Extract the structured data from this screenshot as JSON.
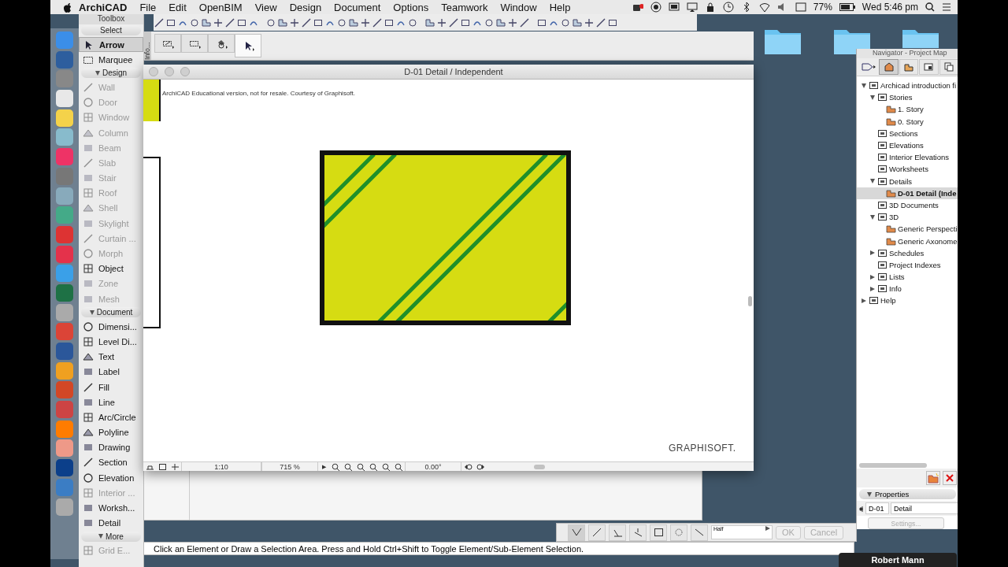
{
  "menu_bar": {
    "app_name": "ArchiCAD",
    "menus": [
      "File",
      "Edit",
      "OpenBIM",
      "View",
      "Design",
      "Document",
      "Options",
      "Teamwork",
      "Window",
      "Help"
    ],
    "battery": "77%",
    "clock": "Wed 5:46 pm"
  },
  "toolbox": {
    "title": "Toolbox",
    "sections": [
      {
        "title": "Select",
        "items": [
          {
            "label": "Arrow",
            "selected": true,
            "disabled": false
          },
          {
            "label": "Marquee",
            "selected": false,
            "disabled": false
          }
        ]
      },
      {
        "title": "Design",
        "expanded": true,
        "items": [
          {
            "label": "Wall",
            "selected": false,
            "disabled": true
          },
          {
            "label": "Door",
            "selected": false,
            "disabled": true
          },
          {
            "label": "Window",
            "selected": false,
            "disabled": true
          },
          {
            "label": "Column",
            "selected": false,
            "disabled": true
          },
          {
            "label": "Beam",
            "selected": false,
            "disabled": true
          },
          {
            "label": "Slab",
            "selected": false,
            "disabled": true
          },
          {
            "label": "Stair",
            "selected": false,
            "disabled": true
          },
          {
            "label": "Roof",
            "selected": false,
            "disabled": true
          },
          {
            "label": "Shell",
            "selected": false,
            "disabled": true
          },
          {
            "label": "Skylight",
            "selected": false,
            "disabled": true
          },
          {
            "label": "Curtain ...",
            "selected": false,
            "disabled": true
          },
          {
            "label": "Morph",
            "selected": false,
            "disabled": true
          },
          {
            "label": "Object",
            "selected": false,
            "disabled": false
          },
          {
            "label": "Zone",
            "selected": false,
            "disabled": true
          },
          {
            "label": "Mesh",
            "selected": false,
            "disabled": true
          }
        ]
      },
      {
        "title": "Document",
        "expanded": true,
        "items": [
          {
            "label": "Dimensi...",
            "selected": false,
            "disabled": false
          },
          {
            "label": "Level Di...",
            "selected": false,
            "disabled": false
          },
          {
            "label": "Text",
            "selected": false,
            "disabled": false
          },
          {
            "label": "Label",
            "selected": false,
            "disabled": false
          },
          {
            "label": "Fill",
            "selected": false,
            "disabled": false
          },
          {
            "label": "Line",
            "selected": false,
            "disabled": false
          },
          {
            "label": "Arc/Circle",
            "selected": false,
            "disabled": false
          },
          {
            "label": "Polyline",
            "selected": false,
            "disabled": false
          },
          {
            "label": "Drawing",
            "selected": false,
            "disabled": false
          },
          {
            "label": "Section",
            "selected": false,
            "disabled": false
          },
          {
            "label": "Elevation",
            "selected": false,
            "disabled": false
          },
          {
            "label": "Interior ...",
            "selected": false,
            "disabled": true
          },
          {
            "label": "Worksh...",
            "selected": false,
            "disabled": false
          },
          {
            "label": "Detail",
            "selected": false,
            "disabled": false
          }
        ]
      },
      {
        "title": "More",
        "expanded": true,
        "items": [
          {
            "label": "Grid E...",
            "selected": false,
            "disabled": true
          }
        ]
      }
    ]
  },
  "info_box": {
    "tab": "Info...",
    "tools": [
      {
        "selected": false
      },
      {
        "selected": false
      },
      {
        "selected": false
      },
      {
        "selected": true
      }
    ]
  },
  "drawing_window": {
    "title": "D-01 Detail / Independent",
    "notice": "ArchiCAD Educational version, not for resale. Courtesy of Graphisoft.",
    "logo": "GRAPHISOFT.",
    "scale": "1:10",
    "zoom": "715 %",
    "play": "▶",
    "angle": "0.00°"
  },
  "navigator": {
    "title": "Navigator - Project Map",
    "tabs": [
      {
        "selected": true
      },
      {
        "selected": false
      },
      {
        "selected": false
      },
      {
        "selected": false
      }
    ],
    "tree": [
      {
        "label": "Archicad introduction fi",
        "expanded": true,
        "selected": false,
        "children": [
          {
            "label": "Stories",
            "expanded": true,
            "selected": false,
            "children": [
              {
                "label": "1. Story",
                "selected": false
              },
              {
                "label": "0. Story",
                "selected": false
              }
            ]
          },
          {
            "label": "Sections",
            "selected": false
          },
          {
            "label": "Elevations",
            "selected": false
          },
          {
            "label": "Interior Elevations",
            "selected": false
          },
          {
            "label": "Worksheets",
            "selected": false
          },
          {
            "label": "Details",
            "expanded": true,
            "selected": false,
            "children": [
              {
                "label": "D-01 Detail (Inde",
                "selected": true
              }
            ]
          },
          {
            "label": "3D Documents",
            "selected": false
          },
          {
            "label": "3D",
            "expanded": true,
            "selected": false,
            "children": [
              {
                "label": "Generic Perspecti",
                "selected": false
              },
              {
                "label": "Generic Axonome",
                "selected": false
              }
            ]
          },
          {
            "label": "Schedules",
            "expanded": false,
            "selected": false
          },
          {
            "label": "Project Indexes",
            "selected": false
          },
          {
            "label": "Lists",
            "expanded": false,
            "selected": false
          },
          {
            "label": "Info",
            "expanded": false,
            "selected": false
          }
        ]
      },
      {
        "label": "Help",
        "expanded": false,
        "selected": false
      }
    ],
    "properties": {
      "title": "Properties",
      "expanded": true,
      "id": "D-01",
      "name": "Detail",
      "settings": "Settings...",
      "settings_disabled": true
    }
  },
  "status_message": "Click an Element or Draw a Selection Area. Press and Hold Ctrl+Shift to Toggle Element/Sub-Element Selection.",
  "pet_palette": {
    "line_type": "Half",
    "ok": "OK",
    "cancel": "Cancel",
    "disabled": true
  },
  "user_name": "Robert Mann"
}
